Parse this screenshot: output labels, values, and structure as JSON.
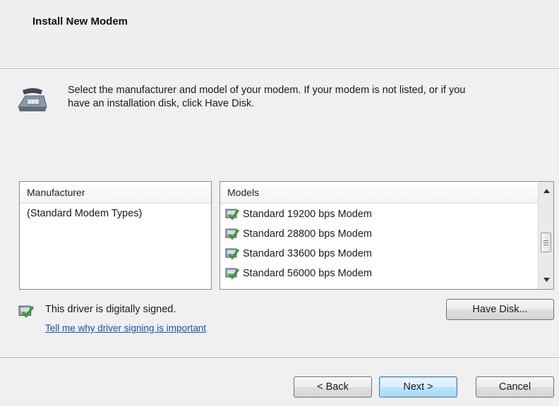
{
  "header": {
    "title": "Install New Modem"
  },
  "intro": {
    "icon": "modem-phone-icon",
    "line1": "Select the manufacturer and model of your modem. If your modem is not listed, or if you",
    "line2": "have an installation disk, click Have Disk."
  },
  "manufacturer_list": {
    "header": "Manufacturer",
    "items": [
      "(Standard Modem Types)"
    ],
    "selected": "(Standard Modem Types)"
  },
  "models_list": {
    "header": "Models",
    "items": [
      {
        "label": "Standard 19200 bps Modem",
        "icon": "signed-driver-icon"
      },
      {
        "label": "Standard 28800 bps Modem",
        "icon": "signed-driver-icon"
      },
      {
        "label": "Standard 33600 bps Modem",
        "icon": "signed-driver-icon"
      },
      {
        "label": "Standard 56000 bps Modem",
        "icon": "signed-driver-icon"
      }
    ]
  },
  "signing": {
    "icon": "signed-driver-icon",
    "text": "This driver is digitally signed.",
    "link": "Tell me why driver signing is important"
  },
  "buttons": {
    "have_disk": "Have Disk...",
    "back": "< Back",
    "next": "Next >",
    "cancel": "Cancel"
  },
  "colors": {
    "background": "#f0f0f0",
    "link": "#1a4fb0",
    "default_button_border": "#3c7fb1"
  }
}
